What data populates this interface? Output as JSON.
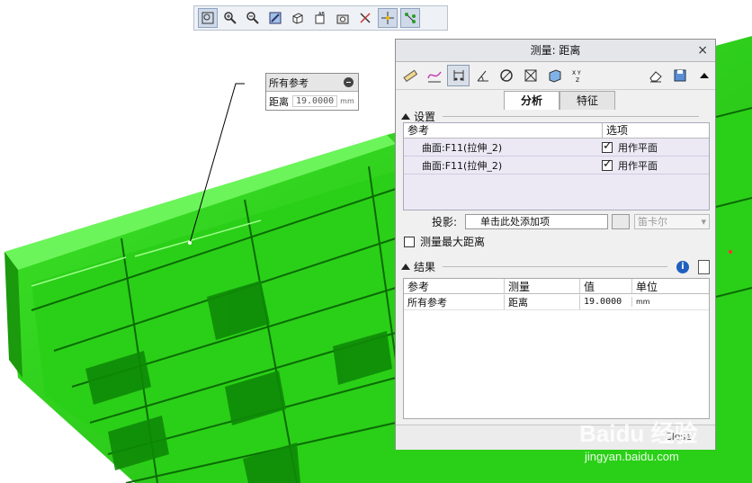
{
  "toolbar": {
    "buttons": [
      "refit-icon",
      "zoom-in-icon",
      "zoom-out-icon",
      "repaint-icon",
      "display-style-icon",
      "named-views-icon",
      "saved-orientation-icon",
      "datum-display-icon",
      "spin-center-icon",
      "annotation-display-icon"
    ]
  },
  "callout": {
    "title": "所有参考",
    "label": "距离",
    "value": "19.0000",
    "unit": "mm"
  },
  "dialog": {
    "title": "测量: 距离",
    "tabs": [
      "分析",
      "特征"
    ],
    "settings": {
      "header": "设置",
      "col_ref": "参考",
      "col_opt": "选项",
      "rows": [
        {
          "ref": "曲面:F11(拉伸_2)",
          "opt": "用作平面"
        },
        {
          "ref": "曲面:F11(拉伸_2)",
          "opt": "用作平面"
        }
      ],
      "projection_label": "投影:",
      "projection_placeholder": "单击此处添加项",
      "coord_system": "笛卡尔",
      "max_distance_label": "测量最大距离"
    },
    "results": {
      "header": "结果",
      "columns": [
        "参考",
        "测量",
        "值",
        "单位"
      ],
      "rows": [
        {
          "ref": "所有参考",
          "measure": "距离",
          "value": "19.0000",
          "unit": "mm"
        }
      ]
    },
    "footer_label": "Close"
  },
  "watermark": {
    "brand": "Baidu 经验",
    "url": "jingyan.baidu.com"
  },
  "colors": {
    "model_green": "#2fd21a",
    "model_dark": "#0c7a06",
    "dialog_bg": "#f0f0f0",
    "selection": "#ece9f5"
  }
}
